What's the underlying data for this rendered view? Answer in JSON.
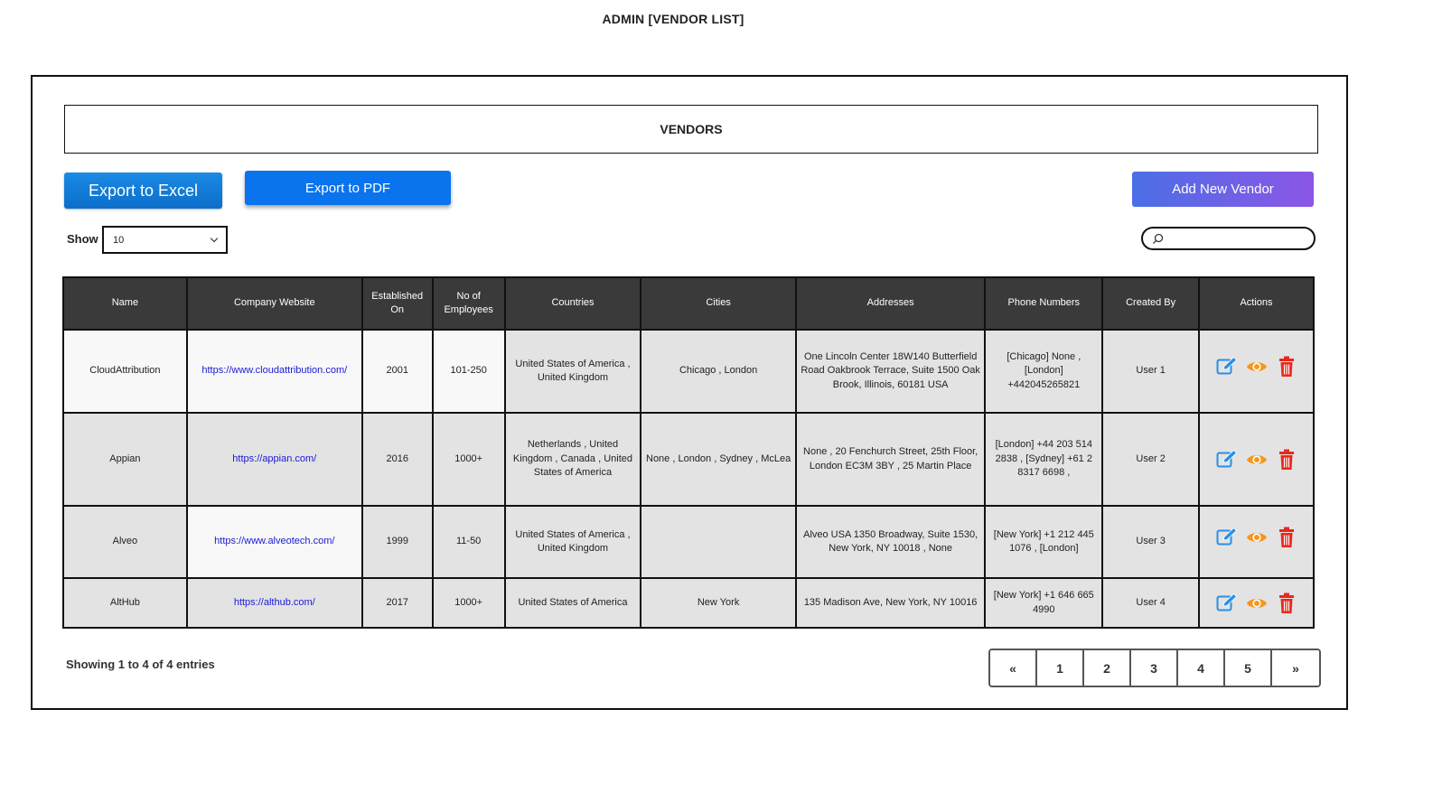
{
  "page_title": "ADMIN [VENDOR LIST]",
  "section_title": "VENDORS",
  "buttons": {
    "export_excel": "Export to Excel",
    "export_pdf": "Export to PDF",
    "add_vendor": "Add New Vendor"
  },
  "show": {
    "label": "Show",
    "value": "10"
  },
  "search": {
    "placeholder": ""
  },
  "table": {
    "headers": [
      "Name",
      "Company Website",
      "Established On",
      "No of Employees",
      "Countries",
      "Cities",
      "Addresses",
      "Phone Numbers",
      "Created By",
      "Actions"
    ],
    "rows": [
      {
        "name": "CloudAttribution",
        "website": "https://www.cloudattribution.com/",
        "established": "2001",
        "employees": "101-250",
        "countries": "United States of America , United Kingdom",
        "cities": "Chicago , London",
        "addresses": "One Lincoln Center 18W140 Butterfield Road Oakbrook Terrace, Suite 1500 Oak Brook, Illinois, 60181 USA",
        "phones": "[Chicago] None , [London] +442045265821",
        "created_by": "User 1"
      },
      {
        "name": "Appian",
        "website": "https://appian.com/",
        "established": "2016",
        "employees": "1000+",
        "countries": "Netherlands , United Kingdom , Canada , United States of America",
        "cities": "None , London , Sydney , McLea",
        "addresses": "None , 20 Fenchurch Street, 25th Floor, London EC3M 3BY , 25 Martin Place",
        "phones": "[London] +44 203 514 2838 , [Sydney] +61 2 8317 6698 ,",
        "created_by": "User 2"
      },
      {
        "name": "Alveo",
        "website": "https://www.alveotech.com/",
        "established": "1999",
        "employees": "11-50",
        "countries": "United States of America , United Kingdom",
        "cities": "",
        "addresses": "Alveo USA 1350 Broadway, Suite 1530, New York, NY 10018 , None",
        "phones": "[New York] +1 212 445 1076 , [London]",
        "created_by": "User 3"
      },
      {
        "name": "AltHub",
        "website": "https://althub.com/",
        "established": "2017",
        "employees": "1000+",
        "countries": "United States of America",
        "cities": "New York",
        "addresses": "135 Madison Ave, New York, NY 10016",
        "phones": "[New York] +1 646 665 4990",
        "created_by": "User 4"
      }
    ],
    "action_icons": [
      "edit-icon",
      "eye-icon",
      "trash-icon"
    ]
  },
  "entries_text": "Showing 1 to 4 of 4 entries",
  "pagination": {
    "prev": "«",
    "pages": [
      "1",
      "2",
      "3",
      "4",
      "5"
    ],
    "next": "»"
  },
  "colors": {
    "excel_button": "#1a8be6",
    "pdf_button": "#0a73ee",
    "add_button_start": "#4b6fe6",
    "add_button_end": "#8c56e6",
    "table_header": "#3a3a3a",
    "edit_icon": "#2a8fe6",
    "eye_icon": "#f5961e",
    "trash_icon": "#e8291c",
    "link": "#1a1ad6"
  }
}
